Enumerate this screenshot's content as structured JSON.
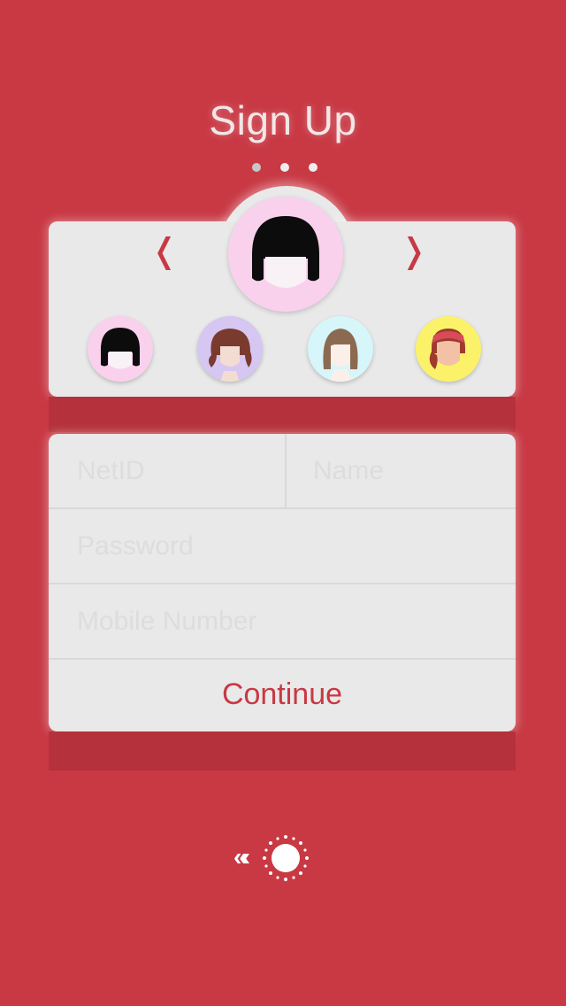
{
  "header": {
    "title": "Sign Up",
    "page_count": 3,
    "active_page": 0
  },
  "avatar_picker": {
    "prev_label": "❬",
    "next_label": "❭",
    "selected": 0,
    "options": [
      {
        "name": "black-bob-hair",
        "bg": "#FAD1EC"
      },
      {
        "name": "auburn-wavy-hair",
        "bg": "#D6C6F2"
      },
      {
        "name": "brown-long-hair",
        "bg": "#D7F6FA"
      },
      {
        "name": "headband-ponytail",
        "bg": "#FBF26A"
      }
    ]
  },
  "form": {
    "netid_placeholder": "NetID",
    "name_placeholder": "Name",
    "password_placeholder": "Password",
    "mobile_placeholder": "Mobile Number",
    "netid_value": "",
    "name_value": "",
    "password_value": "",
    "mobile_value": "",
    "continue_label": "Continue"
  },
  "footer": {
    "back_label": "«‹",
    "sun_icon": "sun-icon"
  },
  "colors": {
    "background": "#C83944",
    "card": "#E9E9E9",
    "accent": "#C83944"
  }
}
